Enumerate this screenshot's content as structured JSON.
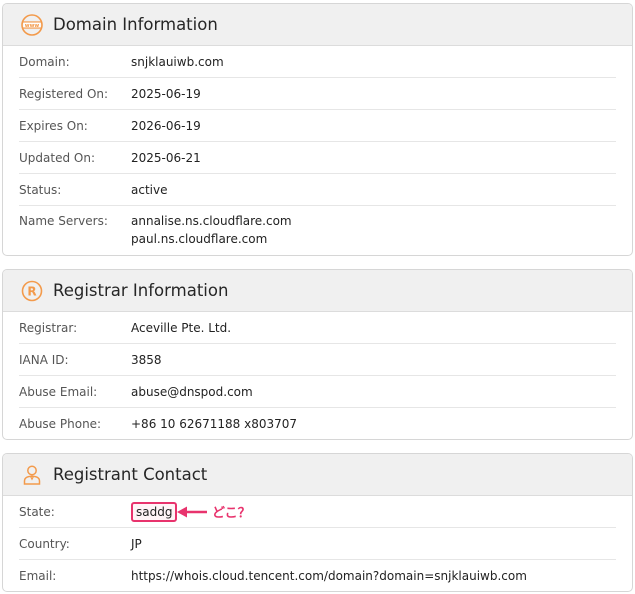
{
  "domain_section": {
    "title": "Domain Information",
    "icon": "www-globe-icon",
    "rows": [
      {
        "label": "Domain:",
        "value": "snjklauiwb.com"
      },
      {
        "label": "Registered On:",
        "value": "2025-06-19"
      },
      {
        "label": "Expires On:",
        "value": "2026-06-19"
      },
      {
        "label": "Updated On:",
        "value": "2025-06-21"
      },
      {
        "label": "Status:",
        "value": "active"
      }
    ],
    "name_servers": {
      "label": "Name Servers:",
      "values": [
        "annalise.ns.cloudflare.com",
        "paul.ns.cloudflare.com"
      ]
    }
  },
  "registrar_section": {
    "title": "Registrar Information",
    "icon": "registered-mark-icon",
    "rows": [
      {
        "label": "Registrar:",
        "value": "Aceville Pte. Ltd."
      },
      {
        "label": "IANA ID:",
        "value": "3858"
      },
      {
        "label": "Abuse Email:",
        "value": "abuse@dnspod.com"
      },
      {
        "label": "Abuse Phone:",
        "value": "+86 10 62671188 x803707"
      }
    ]
  },
  "registrant_section": {
    "title": "Registrant Contact",
    "icon": "person-contact-icon",
    "rows": [
      {
        "label": "State:",
        "value": "saddg"
      },
      {
        "label": "Country:",
        "value": "JP"
      },
      {
        "label": "Email:",
        "value": "https://whois.cloud.tencent.com/domain?domain=snjklauiwb.com"
      }
    ]
  },
  "annotation": {
    "text": "どこ？",
    "color": "#e8336d"
  },
  "accent_color": "#f39a4b"
}
